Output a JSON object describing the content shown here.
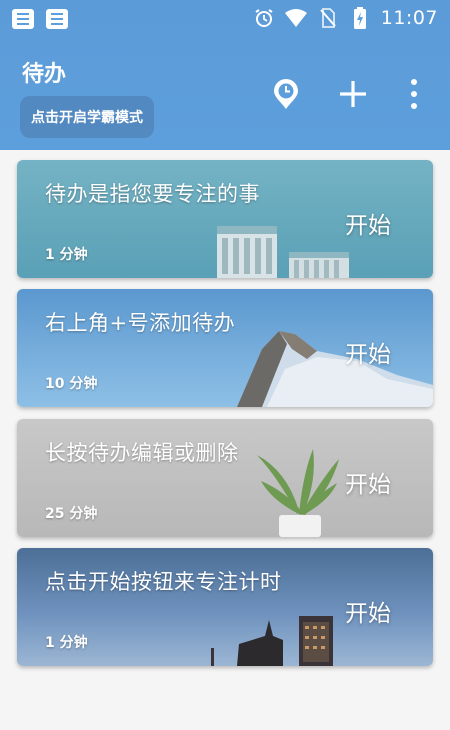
{
  "status_bar": {
    "time": "11:07",
    "left_icons": [
      "app-notification-icon",
      "app-notification-icon"
    ],
    "right_icons": [
      "alarm-icon",
      "wifi-icon",
      "no-sim-icon",
      "battery-charging-icon"
    ]
  },
  "header": {
    "title": "待办",
    "mode_button_label": "点击开启学霸模式",
    "actions": [
      "clock-icon",
      "add-icon",
      "more-vertical-icon"
    ]
  },
  "colors": {
    "header_bg": "#5d9fdc",
    "page_bg": "#f5f5f5",
    "text": "#ffffff"
  },
  "todos": [
    {
      "title": "待办是指您要专注的事",
      "duration": "1 分钟",
      "action_label": "开始",
      "background": "buildings-teal"
    },
    {
      "title": "右上角+号添加待办",
      "duration": "10 分钟",
      "action_label": "开始",
      "background": "snowy-mountain"
    },
    {
      "title": "长按待办编辑或删除",
      "duration": "25 分钟",
      "action_label": "开始",
      "background": "potted-plant"
    },
    {
      "title": "点击开始按钮来专注计时",
      "duration": "1 分钟",
      "action_label": "开始",
      "background": "city-skyline"
    }
  ]
}
